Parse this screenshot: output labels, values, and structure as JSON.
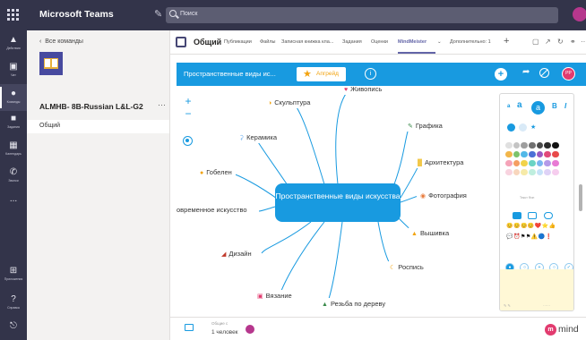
{
  "app": {
    "name": "Microsoft Teams"
  },
  "search": {
    "placeholder": "Поиск"
  },
  "rail": [
    {
      "label": "Действия",
      "icon": "bell-icon"
    },
    {
      "label": "Чат",
      "icon": "chat-icon"
    },
    {
      "label": "Команды",
      "icon": "teams-icon",
      "active": true
    },
    {
      "label": "Задания",
      "icon": "assignments-icon"
    },
    {
      "label": "Календарь",
      "icon": "calendar-icon"
    },
    {
      "label": "Звонки",
      "icon": "phone-icon"
    },
    {
      "label": "...",
      "icon": "more-icon"
    },
    {
      "label": "Приложения",
      "icon": "apps-icon"
    },
    {
      "label": "Справка",
      "icon": "help-icon"
    }
  ],
  "team": {
    "back": "Все команды",
    "name": "ALMHB- 8B-Russian L&L-G2",
    "channel": "Общий"
  },
  "header": {
    "title": "Общий",
    "tabs": [
      "Публикации",
      "Файлы",
      "Записная книжка кла...",
      "Задания",
      "Оценки",
      "MindMeister",
      "Дополнительно: 1"
    ],
    "active_tab": "MindMeister"
  },
  "mindmeister": {
    "map_title": "Пространственные виды ис...",
    "upgrade_label": "Апгрейд",
    "avatar_initials": "PP"
  },
  "map": {
    "central": "Пространственные виды искусства",
    "nodes": [
      "Живопись",
      "Скульптура",
      "Графика",
      "Керамика",
      "Архитектура",
      "Гобелен",
      "Фотография",
      "овременное искусство",
      "Вышивка",
      "Дизайн",
      "Роспись",
      "Вязание",
      "Резьба по дереву"
    ]
  },
  "style_panel": {
    "font_buttons": [
      "a",
      "a",
      "B",
      "I"
    ],
    "swatch_colors": [
      [
        "#e0e0e0",
        "#c4c4c4",
        "#9e9e9e",
        "#707070",
        "#4a4a4a",
        "#2b2b2b",
        "#111111"
      ],
      [
        "#f2b64a",
        "#7cc36b",
        "#52b8e8",
        "#4c6fd6",
        "#9b59c2",
        "#e24a7a",
        "#e84a4a"
      ],
      [
        "#f5a3b8",
        "#f59e62",
        "#f2d34a",
        "#6ad4c4",
        "#7ab6f0",
        "#b49ae8",
        "#e87ad4"
      ],
      [
        "#f8d3df",
        "#f8d6bd",
        "#f6eaa8",
        "#bfeede",
        "#c6e2f8",
        "#ded2f6",
        "#f6cdee"
      ]
    ],
    "small_label": "Текст   Фон",
    "emoji_row1": "😊😊😊😊❤️⭐👍",
    "emoji_row2": "💬⏰⚑⚑⚠️🔵❗"
  },
  "footer": {
    "members_title": "Общие с",
    "members_count": "1 человек",
    "brand": "mind"
  },
  "colors": {
    "teams_dark": "#33344a",
    "teams_purple": "#6264a7",
    "mm_blue": "#189ae0",
    "mm_pink": "#e23b6f"
  }
}
